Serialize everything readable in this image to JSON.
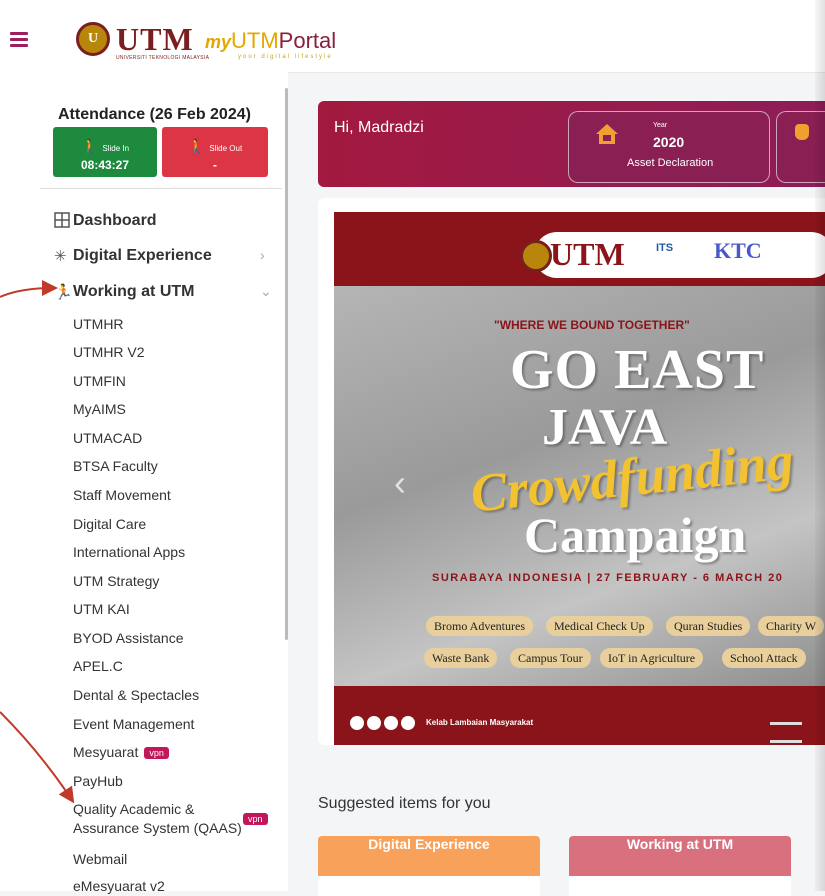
{
  "header": {
    "logo_text": "UTM",
    "logo_subtext": "UNIVERSITI TEKNOLOGI MALAYSIA",
    "portal_my": "my",
    "portal_utm": "UTM",
    "portal_rest": "Portal",
    "tagline": "your digital lifestyle"
  },
  "attendance": {
    "title": "Attendance (26 Feb 2024)",
    "slide_in_label": "Slide In",
    "slide_in_time": "08:43:27",
    "slide_out_label": "Slide Out",
    "slide_out_time": "-"
  },
  "nav": {
    "dashboard": "Dashboard",
    "digital_experience": "Digital Experience",
    "working_at_utm": "Working at UTM",
    "sub_items": [
      "UTMHR",
      "UTMHR V2",
      "UTMFIN",
      "MyAIMS",
      "UTMACAD",
      "BTSA Faculty",
      "Staff Movement",
      "Digital Care",
      "International Apps",
      "UTM Strategy",
      "UTM KAI",
      "BYOD Assistance",
      "APEL.C",
      "Dental & Spectacles",
      "Event Management",
      "Mesyuarat",
      "PayHub",
      "Quality Academic &",
      "Assurance System (QAAS)",
      "Webmail",
      "eMesyuarat v2"
    ],
    "vpn_badge": "vpn"
  },
  "welcome": {
    "greeting": "Hi, Madradzi",
    "asset_year_label": "Year",
    "asset_year": "2020",
    "asset_label": "Asset Declaration"
  },
  "banner": {
    "logo_utm": "UTM",
    "logo_its": "ITS",
    "logo_ktc": "KTC",
    "tagline": "\"WHERE WE BOUND TOGETHER\"",
    "line1": "GO EAST",
    "line2": "JAVA",
    "line3": "Crowdfunding",
    "line4": "Campaign",
    "location": "SURABAYA INDONESIA | 27 FEBRUARY - 6 MARCH 20",
    "chips_row1": [
      "Bromo Adventures",
      "Medical Check Up",
      "Quran Studies",
      "Charity W"
    ],
    "chips_row2": [
      "Waste Bank",
      "Campus Tour",
      "IoT in Agriculture",
      "School Attack"
    ],
    "footer_text": "Kelab Lambaian Masyarakat"
  },
  "suggested": {
    "title": "Suggested items for you",
    "card1": "Digital Experience",
    "card2": "Working at UTM"
  },
  "colors": {
    "primary": "#9c1f5e",
    "slide_in": "#1e8a3e",
    "slide_out": "#dc3545",
    "card1_header": "#f7a15a",
    "card2_header": "#d9707e",
    "annotation": "#c0392b"
  }
}
